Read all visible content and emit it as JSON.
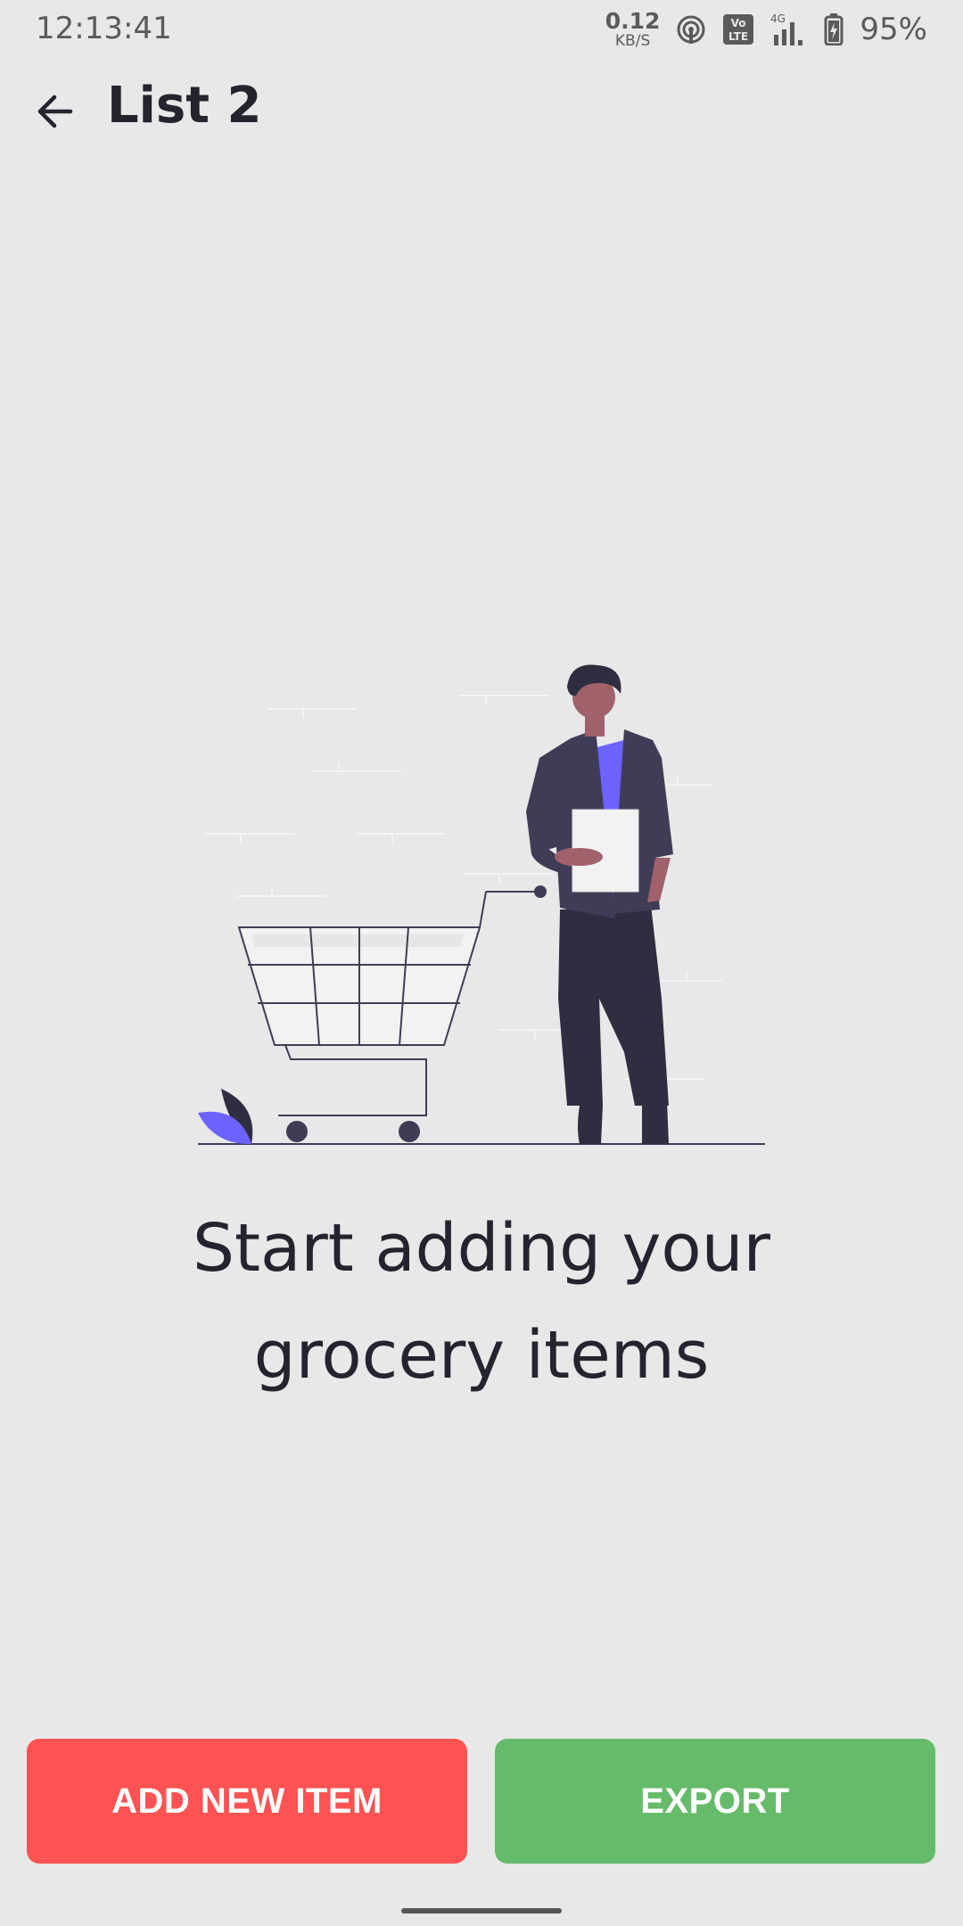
{
  "status_bar": {
    "time": "12:13:41",
    "net_speed_value": "0.12",
    "net_speed_unit": "KB/S",
    "battery": "95%",
    "icons": [
      "hotspot-icon",
      "volte-icon",
      "signal-4g-icon",
      "battery-icon"
    ]
  },
  "app_bar": {
    "title": "List 2",
    "back_icon": "arrow-back-icon"
  },
  "empty_state": {
    "line1": "Start adding your",
    "line2": "grocery items",
    "illustration": "person-with-shopping-cart"
  },
  "actions": {
    "add_label": "ADD NEW ITEM",
    "export_label": "EXPORT"
  },
  "colors": {
    "background": "#e8e8e8",
    "text": "#26232f",
    "add_button": "#ff5252",
    "export_button": "#66bb6a",
    "accent": "#6c63ff"
  }
}
